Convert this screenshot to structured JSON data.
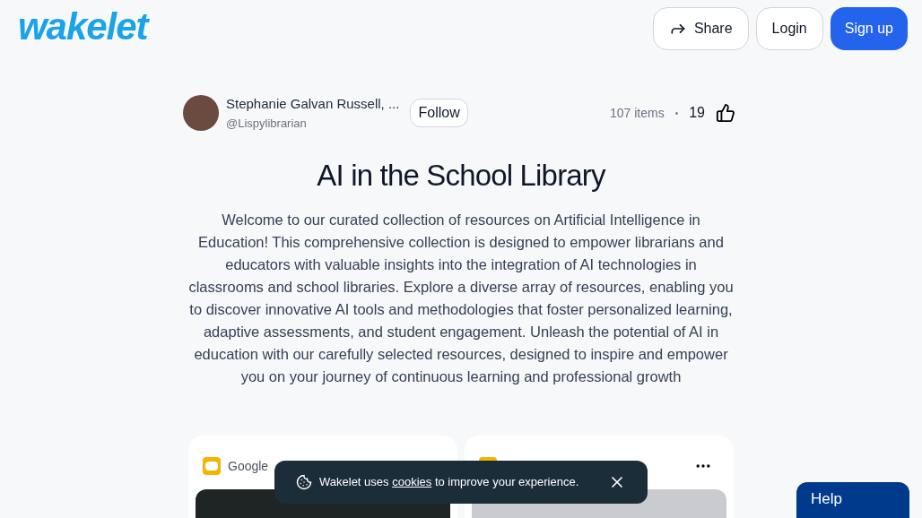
{
  "logo": "wakelet",
  "header_buttons": [
    {
      "kind": "share",
      "label": "Share"
    },
    {
      "kind": "login",
      "label": "Login"
    },
    {
      "kind": "signup",
      "label": "Sign up"
    }
  ],
  "author": {
    "name": "Stephanie Galvan Russell, ...",
    "handle": "@Lispylibrarian",
    "follow_label": "Follow"
  },
  "stats": {
    "items": "107 items",
    "separator": "•",
    "likes": "19"
  },
  "title": "AI in the School Library",
  "description": "Welcome to our curated collection of resources on Artificial Intelligence in Education! This comprehensive collection is designed to empower librarians and educators with valuable insights into the integration of AI technologies in classrooms and school libraries. Explore a diverse array of resources, enabling you to discover innovative AI tools and methodologies that foster personalized learning, adaptive assessments, and student engagement. Unleash the potential of AI in education with our carefully selected resources, designed to inspire and empower you on your journey of continuous learning and professional growth",
  "cards": [
    {
      "kind": "dark",
      "source": "Google"
    },
    {
      "kind": "light"
    }
  ],
  "cookie_banner": {
    "before": "Wakelet uses",
    "link": "cookies",
    "after": "to improve your experience."
  },
  "help_label": "Help"
}
